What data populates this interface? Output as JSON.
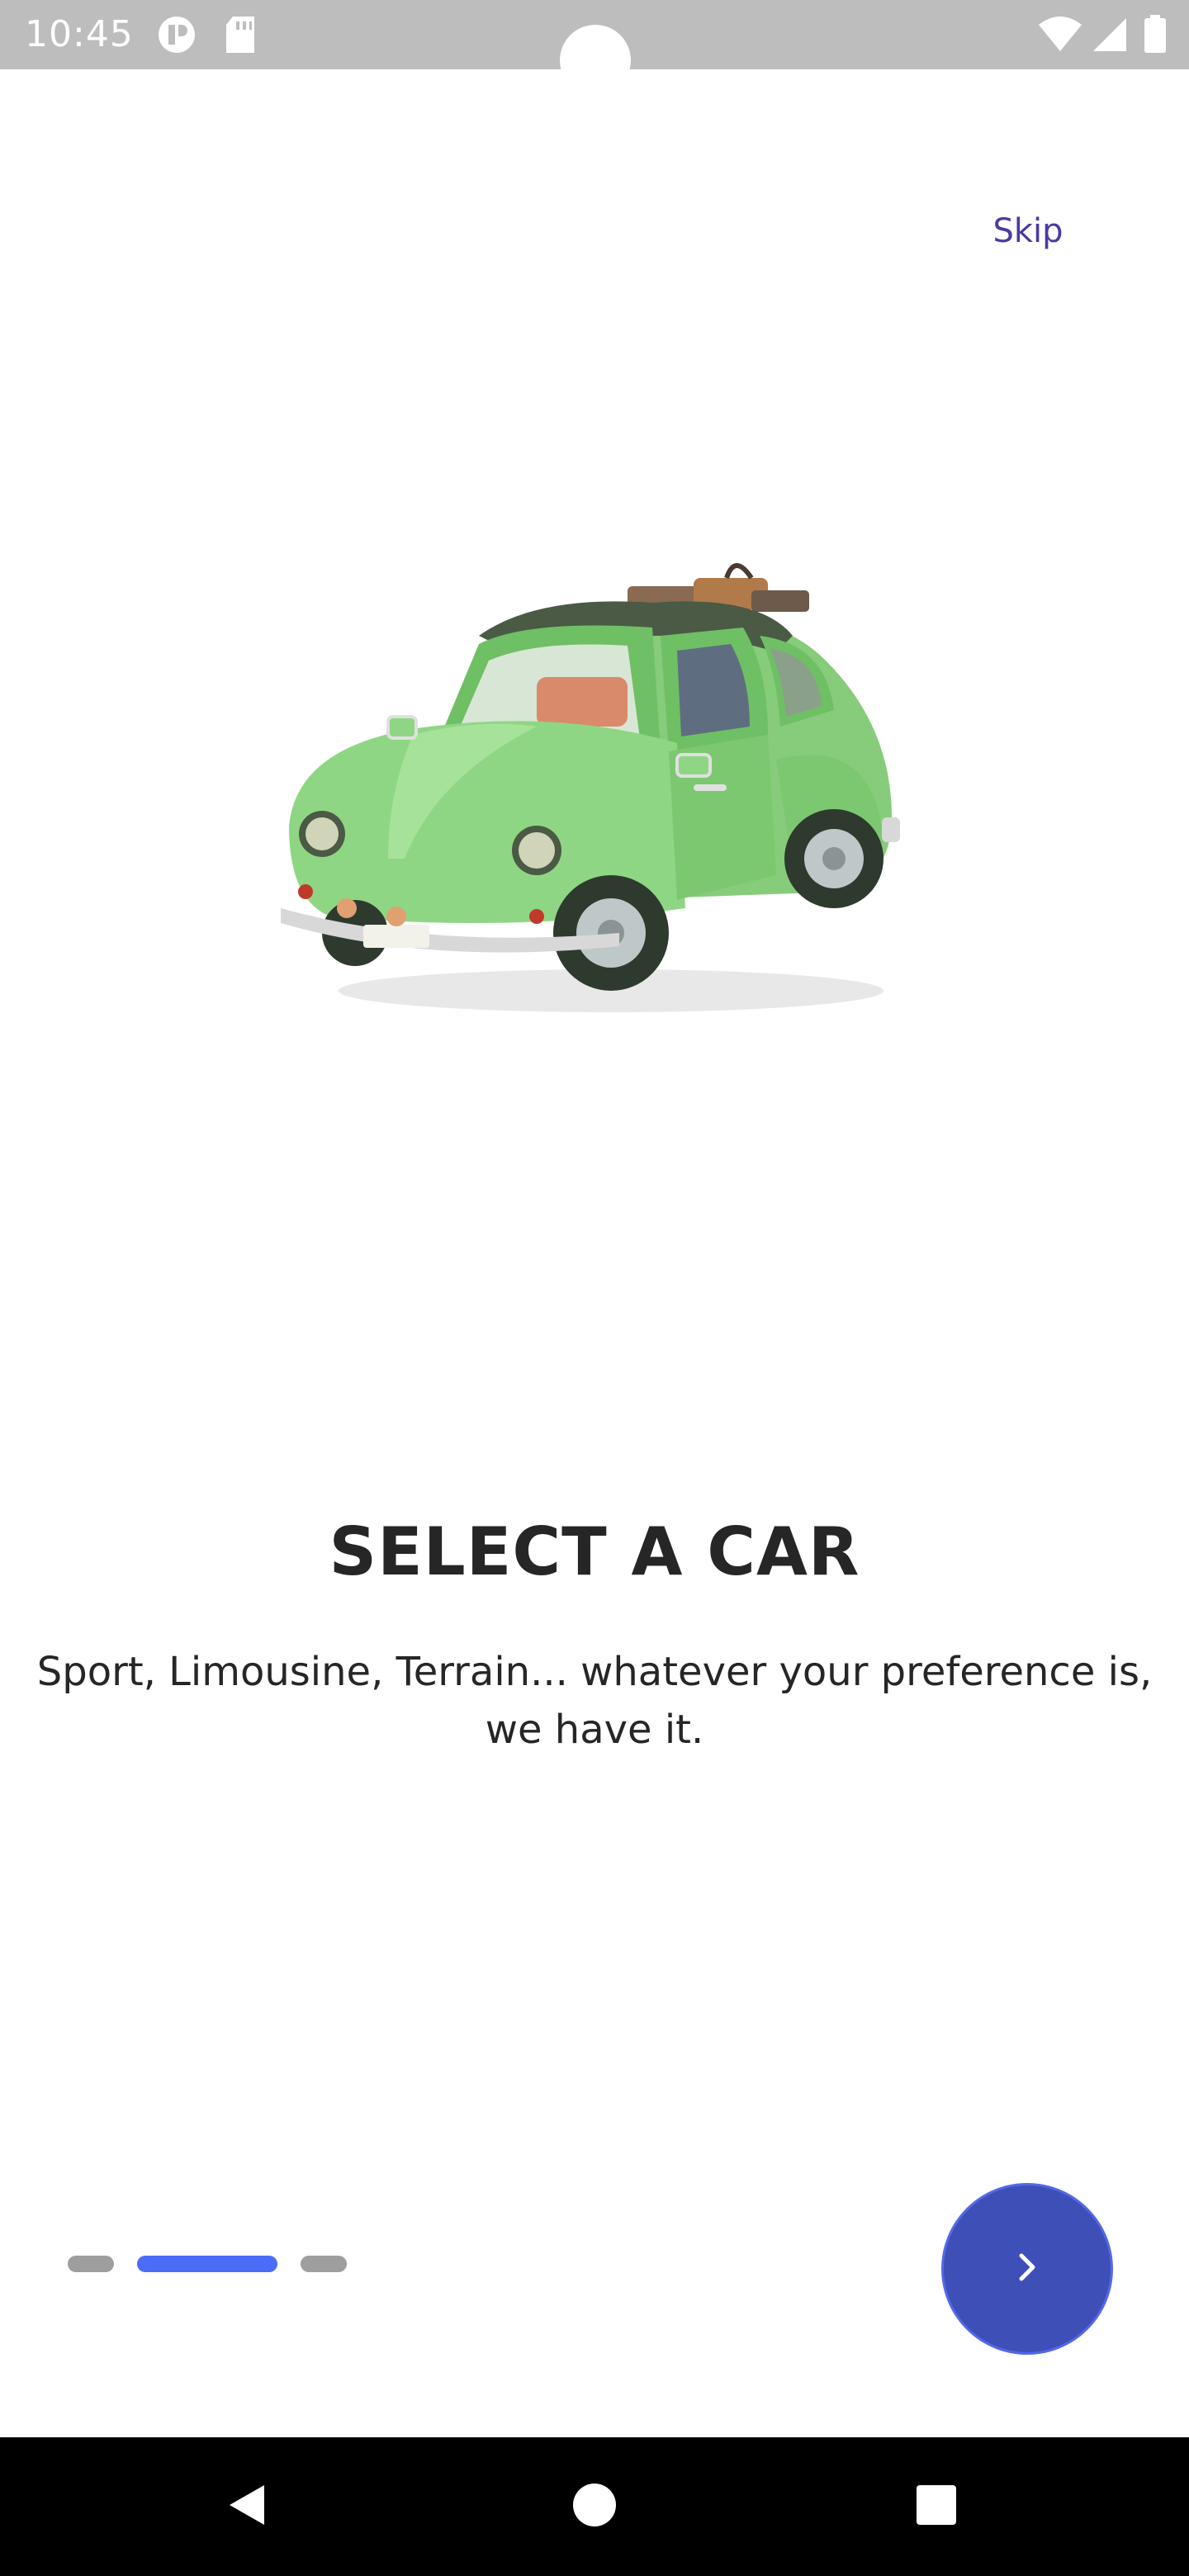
{
  "status_bar": {
    "time": "10:45",
    "icons": [
      "hotspot-icon",
      "sd-card-icon",
      "wifi-icon",
      "signal-icon",
      "battery-icon"
    ]
  },
  "onboarding": {
    "skip_label": "Skip",
    "title": "SELECT A CAR",
    "description": "Sport, Limousine, Terrain... whatever your preference is, we have it.",
    "illustration": "green-vintage-car-illustration",
    "page_indicator": {
      "total": 3,
      "current": 2
    },
    "next_icon": "chevron-right-icon"
  },
  "nav_bar": {
    "buttons": [
      "back-icon",
      "home-icon",
      "recents-icon"
    ]
  },
  "colors": {
    "accent": "#4a6cf7",
    "next_button": "#3e4fb8",
    "skip_text": "#4a3aa0",
    "title_text": "#262626",
    "status_bar": "#bdbdbd",
    "inactive_dot": "#9e9e9e"
  }
}
